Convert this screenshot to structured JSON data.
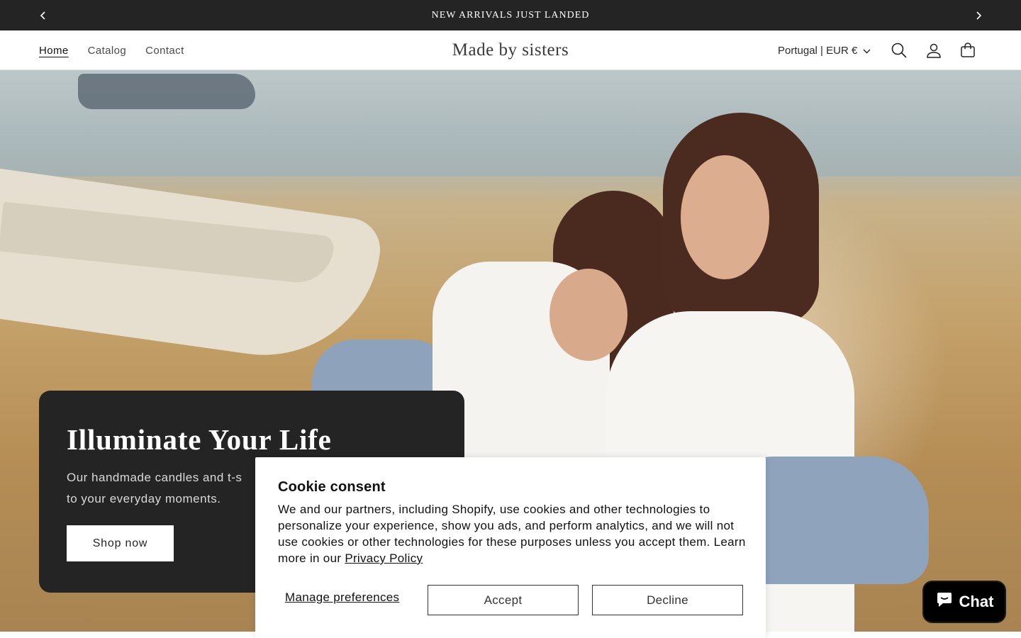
{
  "announcement": {
    "text": "NEW ARRIVALS JUST LANDED",
    "prev_icon": "chevron-left-icon",
    "next_icon": "chevron-right-icon"
  },
  "header": {
    "nav": [
      {
        "label": "Home",
        "active": true
      },
      {
        "label": "Catalog",
        "active": false
      },
      {
        "label": "Contact",
        "active": false
      }
    ],
    "brand": "Made by sisters",
    "locale": "Portugal | EUR €",
    "icons": [
      "search-icon",
      "account-icon",
      "cart-icon"
    ]
  },
  "hero": {
    "title": "Illuminate Your Life",
    "text": "Our handmade candles and t-s",
    "text_line2": "to your everyday moments.",
    "button": "Shop now"
  },
  "cookie": {
    "title": "Cookie consent",
    "text": "We and our partners, including Shopify, use cookies and other technologies to personalize your experience, show you ads, and perform analytics, and we will not use cookies or other technologies for these purposes unless you accept them. Learn more in our",
    "link": "Privacy Policy",
    "manage": "Manage preferences",
    "accept": "Accept",
    "decline": "Decline"
  },
  "chat": {
    "label": "Chat",
    "icon": "chat-bubble-icon"
  },
  "colors": {
    "dark": "#242424",
    "white": "#ffffff",
    "chat_bg": "#000000"
  }
}
